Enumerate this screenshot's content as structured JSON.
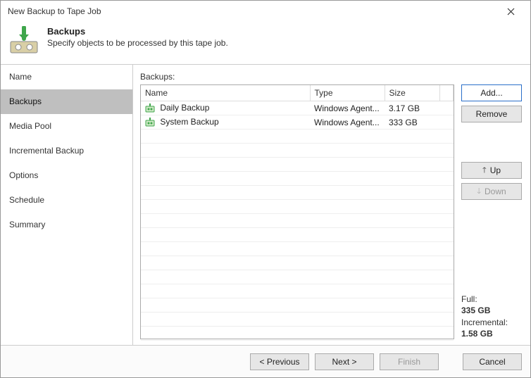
{
  "window": {
    "title": "New Backup to Tape Job"
  },
  "header": {
    "title": "Backups",
    "subtitle": "Specify objects to be processed by this tape job."
  },
  "sidebar": {
    "items": [
      {
        "label": "Name",
        "active": false
      },
      {
        "label": "Backups",
        "active": true
      },
      {
        "label": "Media Pool",
        "active": false
      },
      {
        "label": "Incremental Backup",
        "active": false
      },
      {
        "label": "Options",
        "active": false
      },
      {
        "label": "Schedule",
        "active": false
      },
      {
        "label": "Summary",
        "active": false
      }
    ]
  },
  "main": {
    "label": "Backups:",
    "columns": {
      "name": "Name",
      "type": "Type",
      "size": "Size"
    },
    "rows": [
      {
        "name": "Daily Backup",
        "type": "Windows Agent...",
        "size": "3.17 GB"
      },
      {
        "name": "System Backup",
        "type": "Windows Agent...",
        "size": "333 GB"
      }
    ],
    "buttons": {
      "add": "Add...",
      "remove": "Remove",
      "up": "Up",
      "down": "Down"
    },
    "summary": {
      "full_label": "Full:",
      "full_value": "335 GB",
      "incr_label": "Incremental:",
      "incr_value": "1.58 GB"
    }
  },
  "footer": {
    "previous": "< Previous",
    "next": "Next >",
    "finish": "Finish",
    "cancel": "Cancel"
  }
}
